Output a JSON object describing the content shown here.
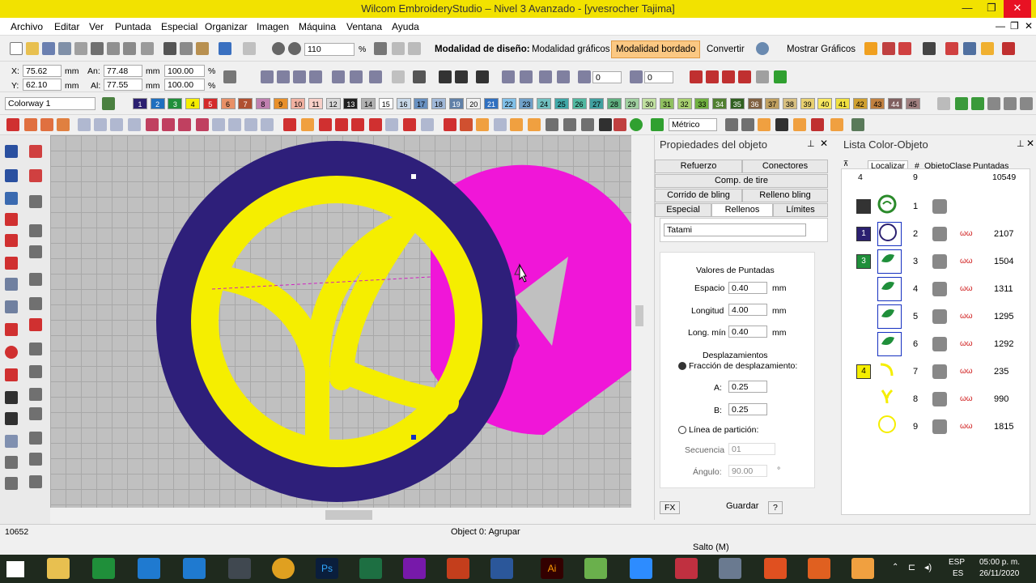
{
  "window": {
    "title": "Wilcom EmbroideryStudio – Nivel 3 Avanzado - [yvesrocher        Tajima]",
    "minimize": "—",
    "maximize": "❐",
    "close": "✕"
  },
  "menu": [
    "Archivo",
    "Editar",
    "Ver",
    "Puntada",
    "Especial",
    "Organizar",
    "Imagen",
    "Máquina",
    "Ventana",
    "Ayuda"
  ],
  "toolbar": {
    "zoom_value": "110",
    "design_mode_label": "Modalidad de diseño:",
    "graphics_mode": "Modalidad gráficos",
    "embroidery_mode": "Modalidad bordado",
    "convert": "Convertir",
    "show_graphics": "Mostrar Gráficos"
  },
  "position": {
    "x_label": "X:",
    "x_value": "75.62",
    "y_label": "Y:",
    "y_value": "62.10",
    "an_label": "An:",
    "an_value": "77.48",
    "al_label": "Al:",
    "al_value": "77.55",
    "unit": "mm",
    "pct_w": "100.00",
    "pct_h": "100.00",
    "pct": "%",
    "rotation": "0",
    "slant": "0"
  },
  "colorway": {
    "name": "Colorway 1",
    "swatches": [
      {
        "n": "1",
        "c": "#2b2070"
      },
      {
        "n": "2",
        "c": "#1f6fbf"
      },
      {
        "n": "3",
        "c": "#1f8f3a"
      },
      {
        "n": "4",
        "c": "#f5ee00"
      },
      {
        "n": "5",
        "c": "#d42a2a"
      },
      {
        "n": "6",
        "c": "#e89066"
      },
      {
        "n": "7",
        "c": "#b05030"
      },
      {
        "n": "8",
        "c": "#c080b0"
      },
      {
        "n": "9",
        "c": "#e8902a"
      },
      {
        "n": "10",
        "c": "#f0b0a0"
      },
      {
        "n": "11",
        "c": "#f8d0c8"
      },
      {
        "n": "12",
        "c": "#d8d8d8"
      },
      {
        "n": "13",
        "c": "#202020"
      },
      {
        "n": "14",
        "c": "#b0b0b0"
      },
      {
        "n": "15",
        "c": "#ffffff"
      },
      {
        "n": "16",
        "c": "#c8d8e8"
      },
      {
        "n": "17",
        "c": "#6890c0"
      },
      {
        "n": "18",
        "c": "#a0b8d8"
      },
      {
        "n": "19",
        "c": "#6080a8"
      },
      {
        "n": "20",
        "c": "#f0f0f0"
      },
      {
        "n": "21",
        "c": "#3070c0"
      },
      {
        "n": "22",
        "c": "#80c0e8"
      },
      {
        "n": "23",
        "c": "#70a0c8"
      },
      {
        "n": "24",
        "c": "#70c0c0"
      },
      {
        "n": "25",
        "c": "#40a8a8"
      },
      {
        "n": "26",
        "c": "#50b8a0"
      },
      {
        "n": "27",
        "c": "#40a0a0"
      },
      {
        "n": "28",
        "c": "#60b080"
      },
      {
        "n": "29",
        "c": "#a0d0a0"
      },
      {
        "n": "30",
        "c": "#c0e0a0"
      },
      {
        "n": "31",
        "c": "#90c060"
      },
      {
        "n": "32",
        "c": "#a8d070"
      },
      {
        "n": "33",
        "c": "#70b040"
      },
      {
        "n": "34",
        "c": "#508030"
      },
      {
        "n": "35",
        "c": "#306020"
      },
      {
        "n": "36",
        "c": "#806040"
      },
      {
        "n": "37",
        "c": "#c0a060"
      },
      {
        "n": "38",
        "c": "#d8c080"
      },
      {
        "n": "39",
        "c": "#e8d070"
      },
      {
        "n": "40",
        "c": "#f8e860"
      },
      {
        "n": "41",
        "c": "#f0e040"
      },
      {
        "n": "42",
        "c": "#d0a030"
      },
      {
        "n": "43",
        "c": "#c08040"
      },
      {
        "n": "44",
        "c": "#806060"
      },
      {
        "n": "45",
        "c": "#a08080"
      }
    ]
  },
  "units_select": "Métrico",
  "props_panel": {
    "title": "Propiedades del objeto",
    "tabs_row1": [
      "Refuerzo",
      "Conectores"
    ],
    "tabs_row2": [
      "Comp. de tire"
    ],
    "tabs_row3": [
      "Corrido de bling",
      "Relleno bling"
    ],
    "tabs_row4": [
      "Especial",
      "Rellenos",
      "Límites"
    ],
    "fill_type": "Tatami",
    "stitch_values_heading": "Valores de Puntadas",
    "spacing_label": "Espacio",
    "spacing": "0.40",
    "length_label": "Longitud",
    "length": "4.00",
    "min_length_label": "Long. mín",
    "min_length": "0.40",
    "unit": "mm",
    "offsets_heading": "Desplazamientos",
    "offset_fraction_label": "Fracción de desplazamiento:",
    "a_label": "A:",
    "a_value": "0.25",
    "b_label": "B:",
    "b_value": "0.25",
    "partition_label": "Línea de partición:",
    "sequence_label": "Secuencia",
    "sequence_value": "01",
    "angle_label": "Ángulo:",
    "angle_value": "90.00",
    "angle_unit": "°",
    "fx": "FX",
    "save": "Guardar",
    "help": "?"
  },
  "color_list": {
    "title": "Lista Color-Objeto",
    "locate": "Localizar",
    "hash": "#",
    "obj_class": "ObjetoClase",
    "stitches_hdr": "Puntadas",
    "summary": {
      "a": "4",
      "b": "9",
      "c": "10549"
    },
    "rows": [
      {
        "num": "1",
        "stitches": "",
        "color": "#ffffff",
        "shape": "ring-green"
      },
      {
        "num": "2",
        "stitches": "2107",
        "color": "#2b2070",
        "shape": "circle-navy"
      },
      {
        "num": "3",
        "stitches": "1504",
        "color": "#1f8f3a",
        "shape": "leaf-green"
      },
      {
        "num": "4",
        "stitches": "1311",
        "color": "#1f8f3a",
        "shape": "leaf-green"
      },
      {
        "num": "5",
        "stitches": "1295",
        "color": "#1f8f3a",
        "shape": "leaf-green"
      },
      {
        "num": "6",
        "stitches": "1292",
        "color": "#1f8f3a",
        "shape": "leaf-green"
      },
      {
        "num": "7",
        "stitches": "235",
        "color": "#f5ee00",
        "shape": "curve-yellow"
      },
      {
        "num": "8",
        "stitches": "990",
        "color": "#f5ee00",
        "shape": "y-yellow"
      },
      {
        "num": "9",
        "stitches": "1815",
        "color": "#f5ee00",
        "shape": "ring-yellow"
      }
    ],
    "group_labels": {
      "g1": "1",
      "g3": "3",
      "g4": "4"
    }
  },
  "status": {
    "count": "10652",
    "object": "Object 0: Agrupar",
    "jump": "Salto (M)"
  },
  "tray": {
    "lang1": "ESP",
    "lang2": "ES",
    "time": "05:00 p. m.",
    "date": "26/11/2020"
  }
}
